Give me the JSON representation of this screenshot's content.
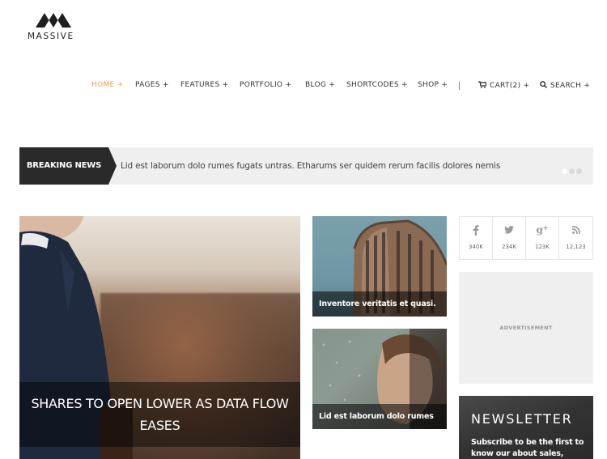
{
  "brand": {
    "name": "MASSIVE"
  },
  "nav": {
    "items": [
      {
        "label": "HOME +",
        "active": true
      },
      {
        "label": "PAGES +"
      },
      {
        "label": "FEATURES +"
      },
      {
        "label": "PORTFOLIO +"
      },
      {
        "label": "BLOG +"
      },
      {
        "label": "SHORTCODES +"
      },
      {
        "label": "SHOP +"
      }
    ],
    "cart_label": "CART(2) +",
    "search_label": "SEARCH +",
    "active_color": "#e0a15c"
  },
  "ticker": {
    "label": "BREAKING NEWS",
    "text": "Lid est laborum dolo rumes fugats untras. Etharums ser quidem rerum facilis dolores nemis",
    "slides": 3,
    "active_slide": 1
  },
  "hero": {
    "title": "SHARES TO OPEN LOWER AS DATA FLOW EASES"
  },
  "tiles": [
    {
      "caption": "Inventore veritatis et quasi."
    },
    {
      "caption": "Lid est laborum dolo rumes"
    }
  ],
  "social": [
    {
      "icon": "facebook-icon",
      "glyph": "f",
      "count": "340K"
    },
    {
      "icon": "twitter-icon",
      "glyph": "t",
      "count": "234K"
    },
    {
      "icon": "google-plus-icon",
      "glyph": "g+",
      "count": "123K"
    },
    {
      "icon": "rss-icon",
      "glyph": "rss",
      "count": "12,123"
    }
  ],
  "ad": {
    "label": "ADVERTISEMENT"
  },
  "newsletter": {
    "title": "NEWSLETTER",
    "text": "Subscribe to be the first to know our about sales,"
  }
}
